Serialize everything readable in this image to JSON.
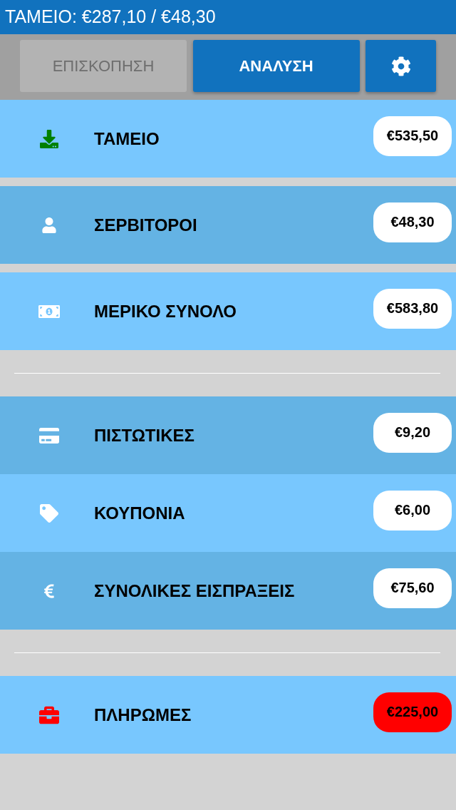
{
  "header": {
    "title": "ΤΑΜΕΙΟ: €287,10 / €48,30"
  },
  "toolbar": {
    "buttons": [
      {
        "label": "ΕΠΙΣΚΟΠΗΣΗ",
        "disabled": true
      },
      {
        "label": "ΑΝΑΛΥΣΗ",
        "disabled": false
      }
    ]
  },
  "sections": [
    {
      "spaced": true,
      "items": [
        {
          "label": "ΤΑΜΕΙΟ",
          "icon": {
            "kind": "download",
            "color": "#008000"
          },
          "badge": {
            "text": "€535,50",
            "color": "#ffffff"
          }
        },
        {
          "label": "ΣΕΡΒΙΤΟΡΟΙ",
          "icon": {
            "kind": "person",
            "color": "#ffffff"
          },
          "badge": {
            "text": "€48,30",
            "color": "#ffffff"
          }
        },
        {
          "label": "ΜΕΡΙΚΟ ΣΥΝΟΛΟ",
          "icon": {
            "kind": "money",
            "color": "#ffffff"
          },
          "badge": {
            "text": "€583,80",
            "color": "#ffffff"
          }
        }
      ]
    },
    {
      "spaced": false,
      "items": [
        {
          "label": "ΠΙΣΤΩΤΙΚΕΣ",
          "icon": {
            "kind": "card",
            "color": "#ffffff"
          },
          "badge": {
            "text": "€9,20",
            "color": "#ffffff"
          }
        },
        {
          "label": "ΚΟΥΠΟΝΙΑ",
          "icon": {
            "kind": "tag",
            "color": "#ffffff"
          },
          "badge": {
            "text": "€6,00",
            "color": "#ffffff"
          }
        },
        {
          "label": "ΣΥΝΟΛΙΚΕΣ ΕΙΣΠΡΑΞΕΙΣ",
          "icon": {
            "kind": "euro",
            "color": "#ffffff"
          },
          "badge": {
            "text": "€75,60",
            "color": "#ffffff"
          }
        }
      ]
    },
    {
      "items": [
        {
          "label": "ΠΛΗΡΩΜΕΣ",
          "icon": {
            "kind": "briefcase",
            "color": "#ff0000"
          },
          "badge": {
            "text": "€225,00",
            "color": "#ff0000"
          }
        }
      ]
    }
  ]
}
